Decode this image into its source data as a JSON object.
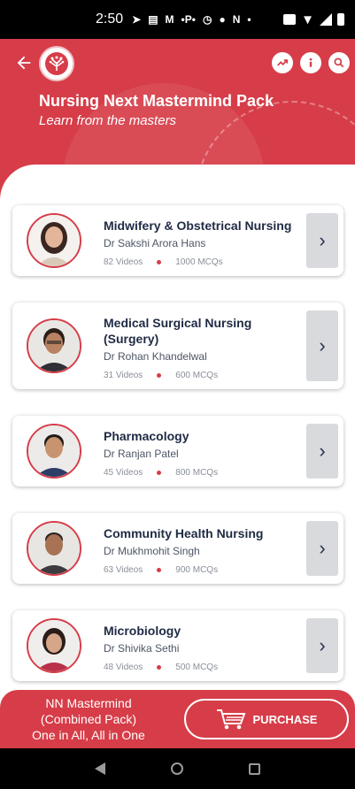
{
  "status_bar": {
    "time": "2:50",
    "icons": [
      "send-icon",
      "news-icon",
      "gmail-icon",
      "paytm-icon",
      "activity-icon",
      "p-icon",
      "n-icon",
      "dot-icon"
    ],
    "text_icons": [
      "M",
      "•P•",
      "N"
    ],
    "right_icons": [
      "vowifi-icon",
      "wifi-icon",
      "signal-icon",
      "battery-icon"
    ]
  },
  "header": {
    "title": "Nursing Next Mastermind Pack",
    "subtitle": "Learn from the masters",
    "accent_color": "#d63d48",
    "actions": [
      "trending-icon",
      "info-icon",
      "search-icon"
    ]
  },
  "courses": [
    {
      "title": "Midwifery & Obstetrical Nursing",
      "author": "Dr Sakshi Arora Hans",
      "videos": "82 Videos",
      "mcqs": "1000 MCQs"
    },
    {
      "title": "Medical Surgical Nursing (Surgery)",
      "author": "Dr Rohan Khandelwal",
      "videos": "31 Videos",
      "mcqs": "600 MCQs"
    },
    {
      "title": "Pharmacology",
      "author": "Dr Ranjan Patel",
      "videos": "45 Videos",
      "mcqs": "800 MCQs"
    },
    {
      "title": "Community Health Nursing",
      "author": "Dr Mukhmohit Singh",
      "videos": "63 Videos",
      "mcqs": "900 MCQs"
    },
    {
      "title": "Microbiology",
      "author": "Dr Shivika Sethi",
      "videos": "48 Videos",
      "mcqs": "500 MCQs"
    }
  ],
  "bottom_bar": {
    "pack_line1": "NN Mastermind",
    "pack_line2": "(Combined Pack)",
    "pack_line3": "One in All, All in One",
    "purchase_label": "PURCHASE"
  }
}
